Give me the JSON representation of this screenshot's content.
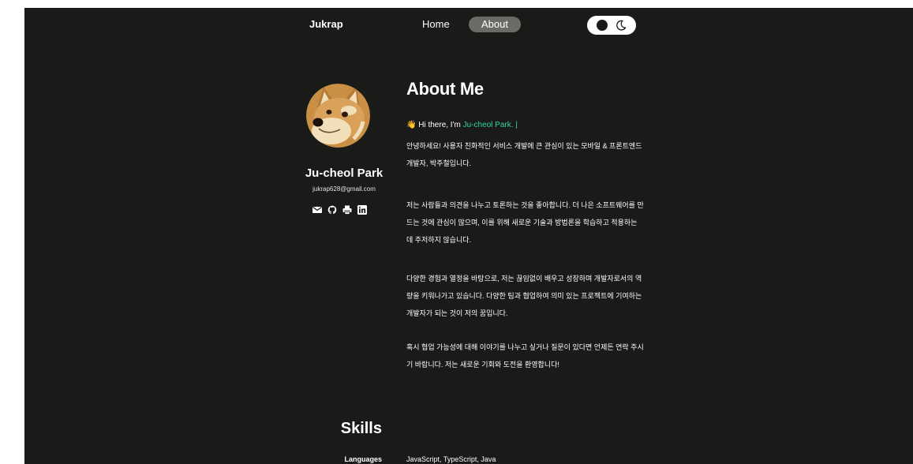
{
  "nav": {
    "brand": "Jukrap",
    "links": [
      {
        "label": "Home",
        "active": false
      },
      {
        "label": "About",
        "active": true
      }
    ],
    "theme_toggle": {
      "icons": [
        "circle-icon",
        "moon-icon"
      ]
    }
  },
  "profile": {
    "name": "Ju-cheol Park",
    "email": "jukrap628@gmail.com",
    "avatar_icon": "shiba-doge-avatar",
    "social_icons": [
      "mail-icon",
      "github-icon",
      "printer-icon",
      "linkedin-icon"
    ]
  },
  "about": {
    "title": "About Me",
    "greeting": {
      "emoji": "👋",
      "prefix": "Hi there, I'm",
      "name": "Ju-cheol Park.",
      "cursor": "|"
    },
    "paragraphs": [
      "안녕하세요! 사용자 친화적인 서비스 개발에 큰 관심이 있는 모바일 & 프론트엔드 개발자, 박주철입니다.",
      "저는 사람들과 의견을 나누고 토론하는 것을 좋아합니다. 더 나은 소프트웨어를 만드는 것에 관심이 많으며, 이를 위해 새로운 기술과 방법론을 학습하고 적용하는 데 주저하지 않습니다.",
      "다양한 경험과 열정을 바탕으로, 저는 끊임없이 배우고 성장하며 개발자로서의 역량을 키워나가고 있습니다. 다양한 팀과 협업하여 의미 있는 프로젝트에 기여하는 개발자가 되는 것이 저의 꿈입니다.",
      "혹시 협업 가능성에 대해 이야기를 나누고 싶거나 질문이 있다면 언제든 연락 주시기 바랍니다. 저는 새로운 기회와 도전을 환영합니다!"
    ]
  },
  "skills": {
    "title": "Skills",
    "rows": [
      {
        "label": "Languages",
        "value": "JavaScript, TypeScript, Java"
      }
    ]
  },
  "colors": {
    "background": "#1a1a18",
    "accent": "#2fd6a6",
    "nav_active": "#6a6a67"
  }
}
